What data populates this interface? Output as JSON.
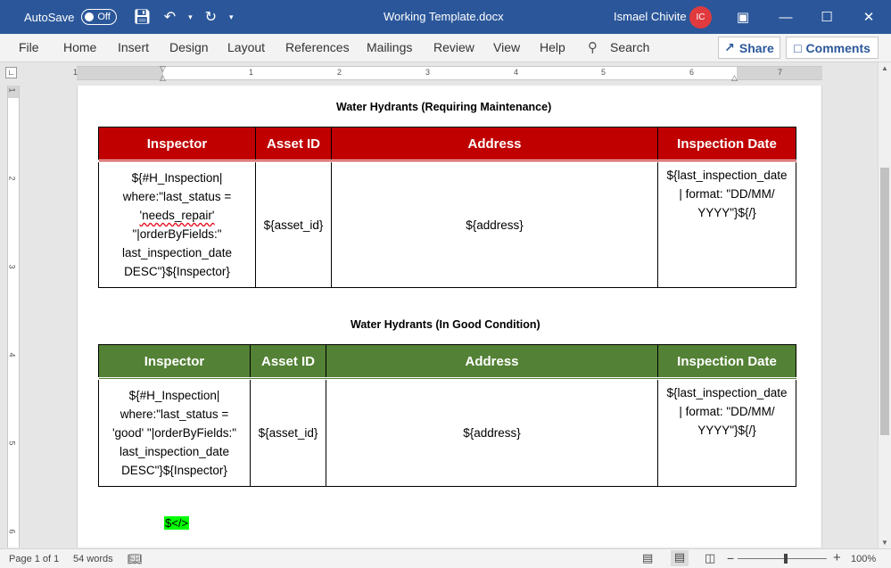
{
  "titlebar": {
    "autosave_label": "AutoSave",
    "autosave_state": "Off",
    "document_title": "Working Template.docx",
    "user_name": "Ismael Chivite",
    "user_initials": "IC"
  },
  "menu": {
    "items": [
      "File",
      "Home",
      "Insert",
      "Design",
      "Layout",
      "References",
      "Mailings",
      "Review",
      "View",
      "Help"
    ],
    "search_label": "Search",
    "share_label": "Share",
    "comments_label": "Comments"
  },
  "ruler": {
    "h_labels": [
      "1",
      "1",
      "2",
      "3",
      "4",
      "5",
      "6",
      "7"
    ],
    "v_labels": [
      "1",
      "2",
      "3",
      "4",
      "5",
      "6"
    ]
  },
  "document": {
    "table1": {
      "title": "Water Hydrants (Requiring Maintenance)",
      "headers": [
        "Inspector",
        "Asset ID",
        "Address",
        "Inspection Date"
      ],
      "inspector_lines": [
        "${#H_Inspection|",
        "where:\"last_status =",
        "'needs_repair'",
        "\"|orderByFields:\"",
        "last_inspection_date",
        "DESC\"}${Inspector}"
      ],
      "asset_id": "${asset_id}",
      "address": "${address}",
      "date_lines": [
        "${last_inspection_date",
        "| format: \"DD/MM/",
        "YYYY\"}${/}"
      ]
    },
    "table2": {
      "title": "Water Hydrants (In Good Condition)",
      "headers": [
        "Inspector",
        "Asset ID",
        "Address",
        "Inspection Date"
      ],
      "inspector_lines": [
        "${#H_Inspection|",
        "where:\"last_status =",
        "'good' \"|orderByFields:\"",
        "last_inspection_date",
        "DESC\"}${Inspector}"
      ],
      "asset_id": "${asset_id}",
      "address": "${address}",
      "date_lines": [
        "${last_inspection_date",
        "| format: \"DD/MM/",
        "YYYY\"}${/}"
      ]
    },
    "closing_tag": "$</>"
  },
  "status": {
    "page": "Page 1 of 1",
    "words": "54 words",
    "zoom": "100%"
  },
  "colors": {
    "title_bar": "#2b579a",
    "table1_header": "#c00000",
    "table2_header": "#538135",
    "highlight": "#00ff00"
  }
}
